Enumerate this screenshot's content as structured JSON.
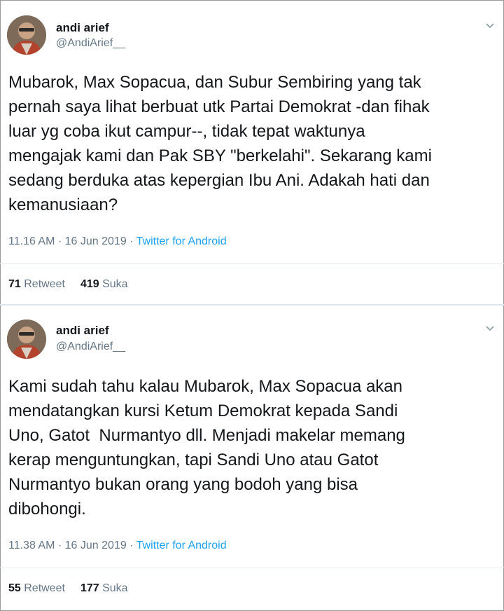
{
  "tweets": [
    {
      "display_name": "andi arief",
      "handle": "@AndiArief__",
      "text": "Mubarok, Max Sopacua, dan Subur Sembiring yang tak\npernah saya lihat berbuat utk Partai Demokrat -dan fihak\nluar yg coba ikut campur--, tidak tepat waktunya\nmengajak kami dan Pak SBY \"berkelahi\". Sekarang kami\nsedang berduka atas kepergian Ibu Ani. Adakah hati dan\nkemanusiaan?",
      "time": "11.16 AM",
      "date": "16 Jun 2019",
      "sep": " · ",
      "source": "Twitter for Android",
      "retweets": "71",
      "retweet_label": "Retweet",
      "likes": "419",
      "like_label": "Suka"
    },
    {
      "display_name": "andi arief",
      "handle": "@AndiArief__",
      "text": "Kami sudah tahu kalau Mubarok, Max Sopacua akan\nmendatangkan kursi Ketum Demokrat kepada Sandi\nUno, Gatot  Nurmantyo dll. Menjadi makelar memang\nkerap menguntungkan, tapi Sandi Uno atau Gatot\nNurmantyo bukan orang yang bodoh yang bisa\ndibohongi.",
      "time": "11.38 AM",
      "date": "16 Jun 2019",
      "sep": " · ",
      "source": "Twitter for Android",
      "retweets": "55",
      "retweet_label": "Retweet",
      "likes": "177",
      "like_label": "Suka"
    }
  ],
  "colors": {
    "text": "#14171a",
    "secondary": "#657786",
    "link": "#1da1f2",
    "divider": "#e6ecf0"
  },
  "icons": {
    "more": "chevron-down-icon",
    "avatar": "profile-photo"
  }
}
